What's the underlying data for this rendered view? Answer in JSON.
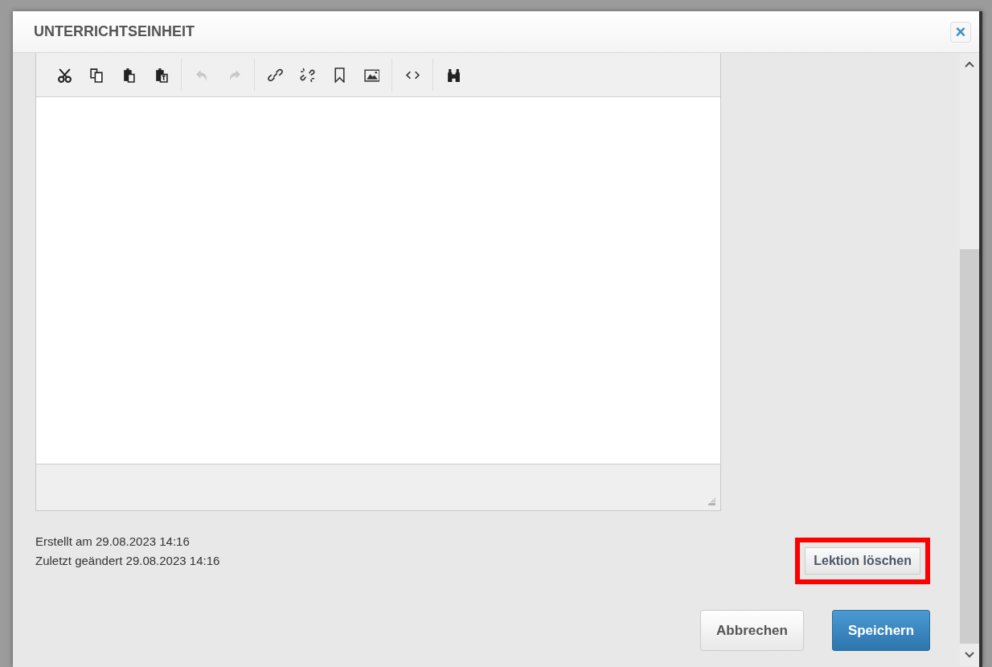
{
  "dialog": {
    "title": "UNTERRICHTSEINHEIT",
    "close_label": "×"
  },
  "editor": {
    "toolbar_groups": [
      [
        {
          "kind": "cut",
          "disabled": false
        },
        {
          "kind": "copy",
          "disabled": false
        },
        {
          "kind": "paste",
          "disabled": false
        },
        {
          "kind": "paste-text",
          "disabled": false
        }
      ],
      [
        {
          "kind": "undo",
          "disabled": true
        },
        {
          "kind": "redo",
          "disabled": true
        }
      ],
      [
        {
          "kind": "link",
          "disabled": false
        },
        {
          "kind": "unlink",
          "disabled": false
        },
        {
          "kind": "bookmark",
          "disabled": false
        },
        {
          "kind": "image",
          "disabled": false
        }
      ],
      [
        {
          "kind": "source",
          "disabled": false
        }
      ],
      [
        {
          "kind": "find",
          "disabled": false
        }
      ]
    ]
  },
  "meta": [
    "Erstellt am 29.08.2023 14:16",
    "Zuletzt geändert 29.08.2023 14:16"
  ],
  "delete_button": {
    "label": "Lektion löschen",
    "highlighted": true
  },
  "buttons": [
    {
      "label": "Abbrechen",
      "kind": "secondary"
    },
    {
      "label": "Speichern",
      "kind": "primary"
    }
  ]
}
